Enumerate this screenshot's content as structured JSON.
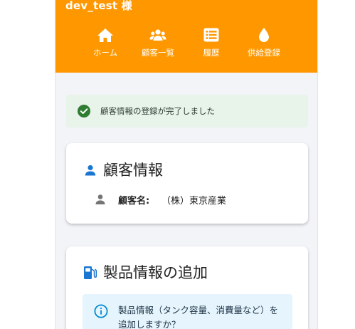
{
  "header": {
    "user_name": "dev_test 様",
    "background_color": "#ff9800",
    "nav": [
      {
        "label": "ホーム",
        "icon": "home-icon"
      },
      {
        "label": "顧客一覧",
        "icon": "users-icon"
      },
      {
        "label": "履歴",
        "icon": "list-icon"
      },
      {
        "label": "供給登録",
        "icon": "drop-icon"
      }
    ]
  },
  "alert": {
    "message": "顧客情報の登録が完了しました",
    "icon": "check-circle-icon",
    "color": "#2e7d32"
  },
  "customer_card": {
    "title": "顧客情報",
    "icon": "person-icon",
    "field_label": "顧客名:",
    "field_value": "（株）東京産業"
  },
  "product_card": {
    "title": "製品情報の追加",
    "icon": "gas-pump-icon",
    "info_text": "製品情報（タンク容量、消費量など）を追加しますか？",
    "info_icon": "info-icon"
  },
  "colors": {
    "accent": "#ff9800",
    "primary_blue": "#1976d2",
    "success": "#2e7d32"
  }
}
